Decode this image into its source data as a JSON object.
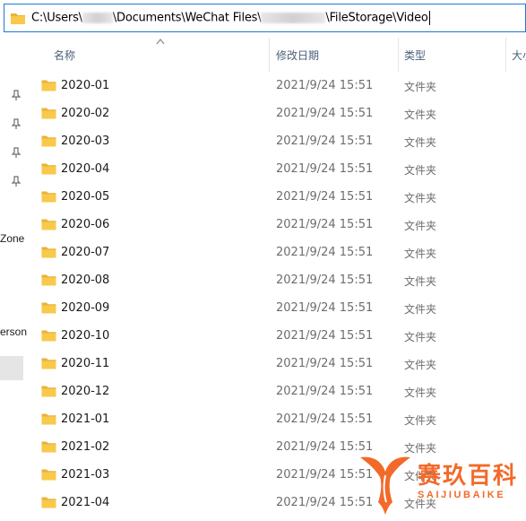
{
  "address_bar": {
    "path_part1": "C:\\Users\\",
    "path_part2": "\\Documents\\WeChat Files\\",
    "path_part3": "\\FileStorage\\Video",
    "icon": "folder-icon"
  },
  "nav_pane": {
    "fragment_1": "Zone",
    "fragment_2": "erson",
    "pin_icon": "pin-icon"
  },
  "columns": {
    "name": "名称",
    "date_modified": "修改日期",
    "type": "类型",
    "size": "大小"
  },
  "rows": [
    {
      "name": "2020-01",
      "date": "2021/9/24 15:51",
      "type": "文件夹"
    },
    {
      "name": "2020-02",
      "date": "2021/9/24 15:51",
      "type": "文件夹"
    },
    {
      "name": "2020-03",
      "date": "2021/9/24 15:51",
      "type": "文件夹"
    },
    {
      "name": "2020-04",
      "date": "2021/9/24 15:51",
      "type": "文件夹"
    },
    {
      "name": "2020-05",
      "date": "2021/9/24 15:51",
      "type": "文件夹"
    },
    {
      "name": "2020-06",
      "date": "2021/9/24 15:51",
      "type": "文件夹"
    },
    {
      "name": "2020-07",
      "date": "2021/9/24 15:51",
      "type": "文件夹"
    },
    {
      "name": "2020-08",
      "date": "2021/9/24 15:51",
      "type": "文件夹"
    },
    {
      "name": "2020-09",
      "date": "2021/9/24 15:51",
      "type": "文件夹"
    },
    {
      "name": "2020-10",
      "date": "2021/9/24 15:51",
      "type": "文件夹"
    },
    {
      "name": "2020-11",
      "date": "2021/9/24 15:51",
      "type": "文件夹"
    },
    {
      "name": "2020-12",
      "date": "2021/9/24 15:51",
      "type": "文件夹"
    },
    {
      "name": "2021-01",
      "date": "2021/9/24 15:51",
      "type": "文件夹"
    },
    {
      "name": "2021-02",
      "date": "2021/9/24 15:51",
      "type": "文件夹"
    },
    {
      "name": "2021-03",
      "date": "2021/9/24 15:51",
      "type": "文件夹"
    },
    {
      "name": "2021-04",
      "date": "2021/9/24 15:51",
      "type": "文件夹"
    }
  ],
  "watermark": {
    "chinese": "赛玖百科",
    "english": "SAIJIUBAIKE"
  },
  "colors": {
    "address_border": "#1c7ad6",
    "folder_yellow": "#f8c94a",
    "watermark_orange": "#f26a2a",
    "header_text": "#4c607a"
  }
}
